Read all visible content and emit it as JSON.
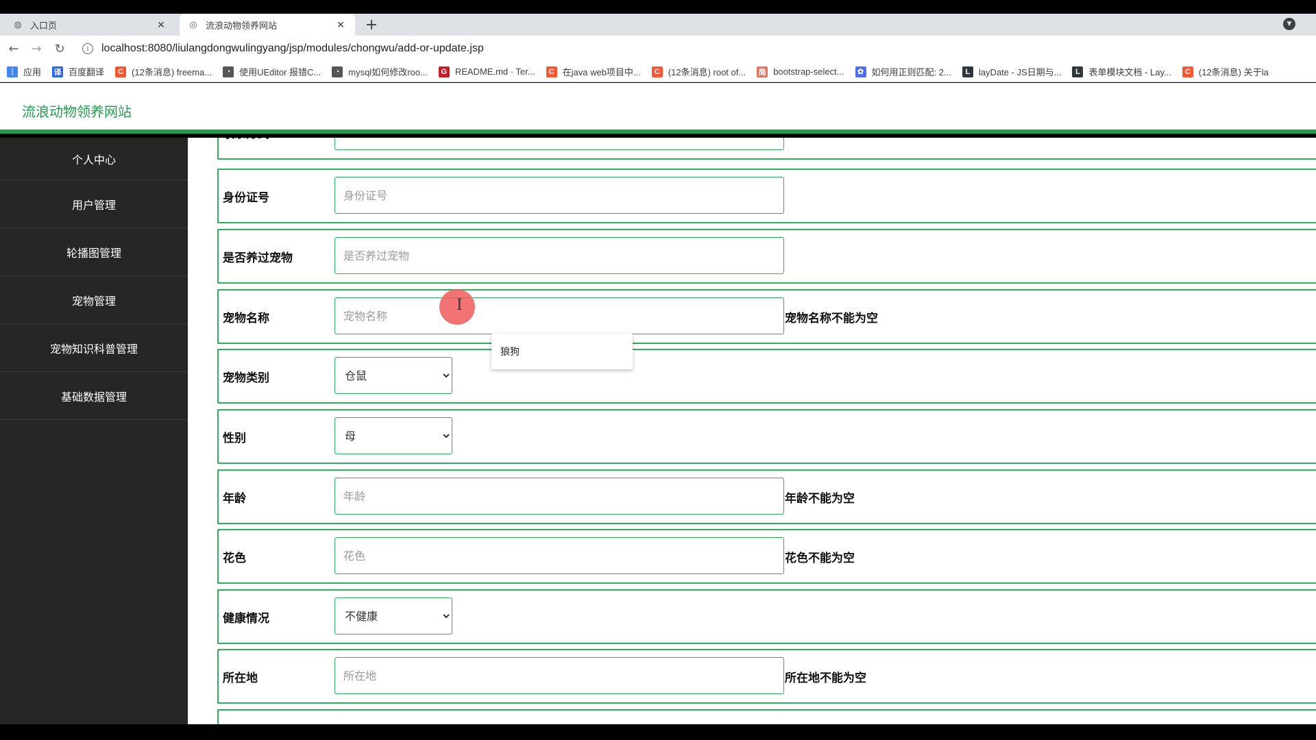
{
  "browser": {
    "tabs": [
      {
        "title": "入口页",
        "active": false
      },
      {
        "title": "流浪动物领养网站",
        "active": true
      }
    ],
    "url": "localhost:8080/liulangdongwulingyang/jsp/modules/chongwu/add-or-update.jsp",
    "bookmarks": [
      {
        "label": "应用",
        "icon_color": "#4285f4",
        "icon_char": "⋮"
      },
      {
        "label": "百度翻译",
        "icon_color": "#2468f2",
        "icon_char": "译"
      },
      {
        "label": "(12条消息) freema...",
        "icon_color": "#fc5531",
        "icon_char": "C"
      },
      {
        "label": "使用UEditor 报错C...",
        "icon_color": "#555555",
        "icon_char": "◔"
      },
      {
        "label": "mysql如何修改roo...",
        "icon_color": "#555555",
        "icon_char": "◔"
      },
      {
        "label": "README.md · Ter...",
        "icon_color": "#c71d23",
        "icon_char": "G"
      },
      {
        "label": "在java web项目中...",
        "icon_color": "#fc5531",
        "icon_char": "C"
      },
      {
        "label": "(12条消息) root of...",
        "icon_color": "#fc5531",
        "icon_char": "C"
      },
      {
        "label": "bootstrap-select...",
        "icon_color": "#ea6f5a",
        "icon_char": "简"
      },
      {
        "label": "如何用正则匹配: 2...",
        "icon_color": "#4e6ef2",
        "icon_char": "✿"
      },
      {
        "label": "layDate - JS日期与...",
        "icon_color": "#2f363c",
        "icon_char": "L"
      },
      {
        "label": "表单模块文档 - Lay...",
        "icon_color": "#2f363c",
        "icon_char": "L"
      },
      {
        "label": "(12条消息) 关于la",
        "icon_color": "#fc5531",
        "icon_char": "C"
      }
    ]
  },
  "app": {
    "title": "流浪动物领养网站",
    "sidebar": [
      "个人中心",
      "用户管理",
      "轮播图管理",
      "宠物管理",
      "宠物知识科普管理",
      "基础数据管理"
    ],
    "form": {
      "partial_top": {
        "label": "联系方式",
        "placeholder": "联系方式"
      },
      "rows": [
        {
          "label": "身份证号",
          "type": "input",
          "placeholder": "身份证号",
          "error": ""
        },
        {
          "label": "是否养过宠物",
          "type": "input",
          "placeholder": "是否养过宠物",
          "error": ""
        },
        {
          "label": "宠物名称",
          "type": "input",
          "placeholder": "宠物名称",
          "error": "宠物名称不能为空"
        },
        {
          "label": "宠物类别",
          "type": "select",
          "value": "仓鼠",
          "error": ""
        },
        {
          "label": "性别",
          "type": "select",
          "value": "母",
          "error": ""
        },
        {
          "label": "年龄",
          "type": "input",
          "placeholder": "年龄",
          "error": "年龄不能为空"
        },
        {
          "label": "花色",
          "type": "input",
          "placeholder": "花色",
          "error": "花色不能为空"
        },
        {
          "label": "健康情况",
          "type": "select",
          "value": "不健康",
          "error": ""
        },
        {
          "label": "所在地",
          "type": "input",
          "placeholder": "所在地",
          "error": "所在地不能为空"
        }
      ],
      "autocomplete_suggestion": "狼狗"
    }
  }
}
